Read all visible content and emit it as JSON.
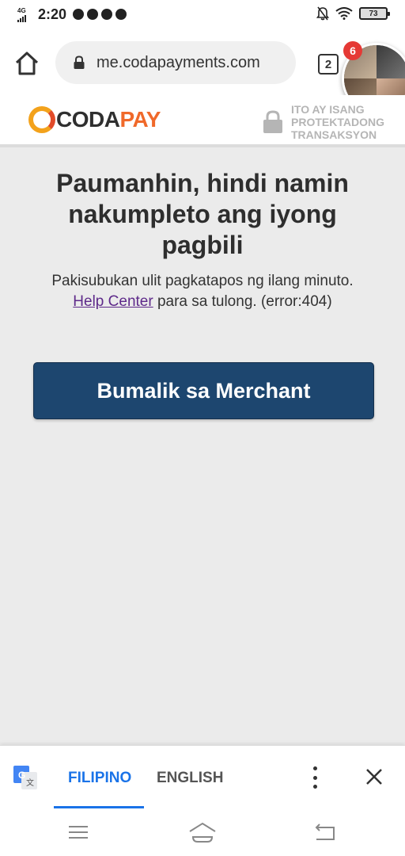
{
  "status_bar": {
    "network": "4G",
    "time": "2:20",
    "battery": "73"
  },
  "browser": {
    "url": "me.codapayments.com",
    "tab_count": "2",
    "chat_badge_count": "6"
  },
  "site_header": {
    "logo_part1": "CODA",
    "logo_part2": "PAY",
    "secure_text_line1": "ITO AY ISANG",
    "secure_text_line2": "PROTEKTADONG",
    "secure_text_line3": "TRANSAKSYON"
  },
  "main": {
    "title": "Paumanhin, hindi namin nakumpleto ang iyong pagbili",
    "message_before": "Pakisubukan ulit pagkatapos ng ilang minuto.",
    "help_link": "Help Center",
    "message_after": " para sa tulong. (error:404)",
    "return_button": "Bumalik sa Merchant"
  },
  "translate_bar": {
    "lang_selected": "FILIPINO",
    "lang_other": "ENGLISH"
  },
  "colors": {
    "button_bg": "#1d466f",
    "link": "#5e2a8a",
    "accent_orange": "#f0692a",
    "translate_blue": "#1a73e8"
  }
}
